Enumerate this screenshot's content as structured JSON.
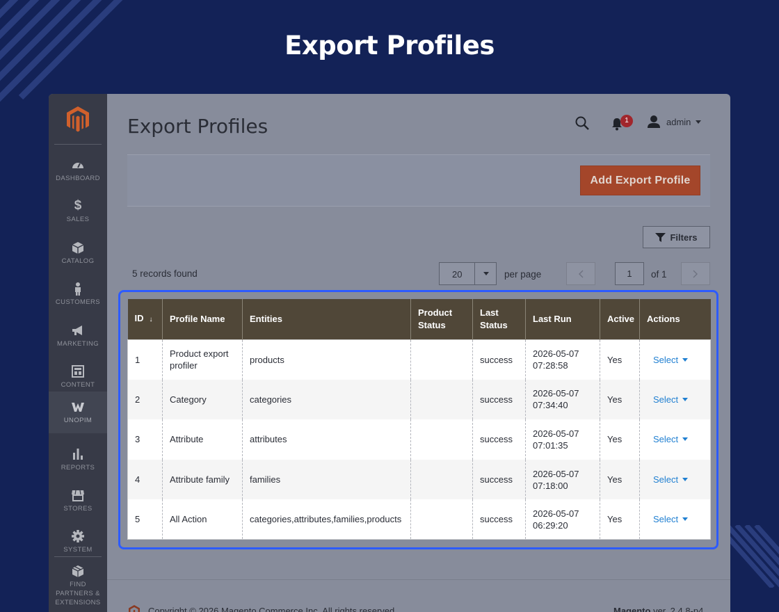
{
  "hero": {
    "title": "Export Profiles"
  },
  "sidebar": {
    "items": [
      {
        "label": "DASHBOARD",
        "icon": "dashboard-icon"
      },
      {
        "label": "SALES",
        "icon": "dollar-icon"
      },
      {
        "label": "CATALOG",
        "icon": "box-icon"
      },
      {
        "label": "CUSTOMERS",
        "icon": "person-icon"
      },
      {
        "label": "MARKETING",
        "icon": "megaphone-icon"
      },
      {
        "label": "CONTENT",
        "icon": "layout-icon"
      },
      {
        "label": "UNOPIM",
        "icon": "unopim-icon"
      },
      {
        "label": "REPORTS",
        "icon": "bar-chart-icon"
      },
      {
        "label": "STORES",
        "icon": "store-icon"
      },
      {
        "label": "SYSTEM",
        "icon": "gear-icon"
      },
      {
        "label": "FIND PARTNERS & EXTENSIONS",
        "icon": "box-stack-icon"
      }
    ],
    "active": "UNOPIM"
  },
  "header": {
    "title": "Export Profiles",
    "notification_count": "1",
    "user": "admin"
  },
  "actions": {
    "add_button": "Add Export Profile"
  },
  "toolbar": {
    "filters": "Filters",
    "records": "5 records found",
    "per_page_value": "20",
    "per_page_label": "per page",
    "page": "1",
    "of_pages": "of 1"
  },
  "table": {
    "columns": [
      "ID",
      "Profile Name",
      "Entities",
      "Product Status",
      "Last Status",
      "Last Run",
      "Active",
      "Actions"
    ],
    "rows": [
      {
        "id": "1",
        "name": "Product export profiler",
        "entities": "products",
        "product_status": "",
        "last_status": "success",
        "last_run": "2026-05-07 07:28:58",
        "active": "Yes",
        "action": "Select"
      },
      {
        "id": "2",
        "name": "Category",
        "entities": "categories",
        "product_status": "",
        "last_status": "success",
        "last_run": "2026-05-07 07:34:40",
        "active": "Yes",
        "action": "Select"
      },
      {
        "id": "3",
        "name": "Attribute",
        "entities": "attributes",
        "product_status": "",
        "last_status": "success",
        "last_run": "2026-05-07 07:01:35",
        "active": "Yes",
        "action": "Select"
      },
      {
        "id": "4",
        "name": "Attribute family",
        "entities": "families",
        "product_status": "",
        "last_status": "success",
        "last_run": "2026-05-07 07:18:00",
        "active": "Yes",
        "action": "Select"
      },
      {
        "id": "5",
        "name": "All Action",
        "entities": "categories,attributes,families,products",
        "product_status": "",
        "last_status": "success",
        "last_run": "2026-05-07 06:29:20",
        "active": "Yes",
        "action": "Select"
      }
    ]
  },
  "footer": {
    "copyright": "Copyright © 2026 Magento Commerce Inc. All rights reserved.",
    "brand": "Magento",
    "version": "ver. 2.4.8-p4"
  },
  "colors": {
    "background": "#132257",
    "sidebar": "#373a47",
    "accent": "#a4462a",
    "table_header": "#504738",
    "highlight": "#2d5bff",
    "link": "#1f7fd1"
  }
}
